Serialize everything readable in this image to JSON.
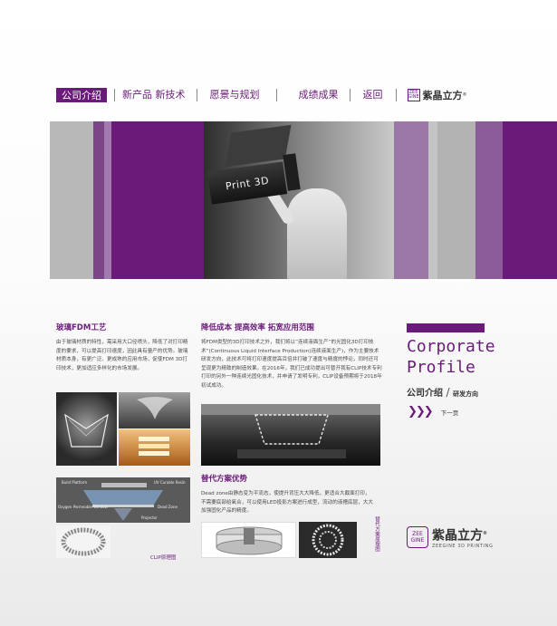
{
  "nav": {
    "items": [
      {
        "label": "公司介绍",
        "active": true
      },
      {
        "label": "新产品 新技术",
        "active": false
      },
      {
        "label": "愿景与规划",
        "active": false
      },
      {
        "label": "成绩成果",
        "active": false
      },
      {
        "label": "返回",
        "active": false
      }
    ],
    "logo_text": "紫晶立方",
    "logo_mark": "ZEE GINE"
  },
  "banner": {
    "cube_text": "Print 3D"
  },
  "left_col": {
    "title": "玻璃FDM工艺",
    "body": "由于玻璃材质的特性，需采用大口径喷头，降低了对打印精度的要求，可以提高打印速度，因此具有量产的优势。玻璃材质本身，有更广泛、更成熟的应用市场，促使FDM 3D打印技术，更加适应多样化的市场发展。",
    "caption": "CLIP原理图",
    "diagram_labels": [
      "Build Platform",
      "UV Curable Resin",
      "Oxygen Permeable Window",
      "Dead Zone",
      "Projector"
    ]
  },
  "mid_col": {
    "title": "降低成本  提高效率  拓宽应用范围",
    "body": "将FDM类型的3D打印技术之外，我们将以“连续液面生产”的光固化3D打印技术”(Continuous Liquid Interface Production)连续液面生产)，作为主要技术研发方向，此技术可将打印速度提高百倍并打破了速度与精度的悖论，同时还可呈现更为精致的制造效果。在2016年，我们已成功提出可替开我有CLIP技术专利打印的另外一种连续光固化技术，并申请了发明专利，CLIP设备预期将于2018年初试成功。",
    "title2": "替代方案优势",
    "body2": "Dead zone由静态变为平流态，使提升背压大大降低，更适合大截面打印，不需要底部给氧合，可以使用LED投影方案进行成型，流动的液槽底层，大大加强固化产品的精度。",
    "caption": "替代方案原理图"
  },
  "right_col": {
    "heading_line1": "Corporate",
    "heading_line2": "Profile",
    "subtitle": "公司介绍",
    "subtitle_small": "研发方向",
    "next_arrows": "❯❯❯",
    "next_label": "下一页",
    "brand_cn": "紫晶立方",
    "brand_en": "ZEEGINE 3D PRINTING",
    "brand_mark": "ZEE GINE",
    "brand_reg": "®"
  },
  "colors": {
    "accent": "#6a1b7a",
    "banner_purple": "#6a1b7a",
    "banner_light_purple": "#8b5c98"
  }
}
